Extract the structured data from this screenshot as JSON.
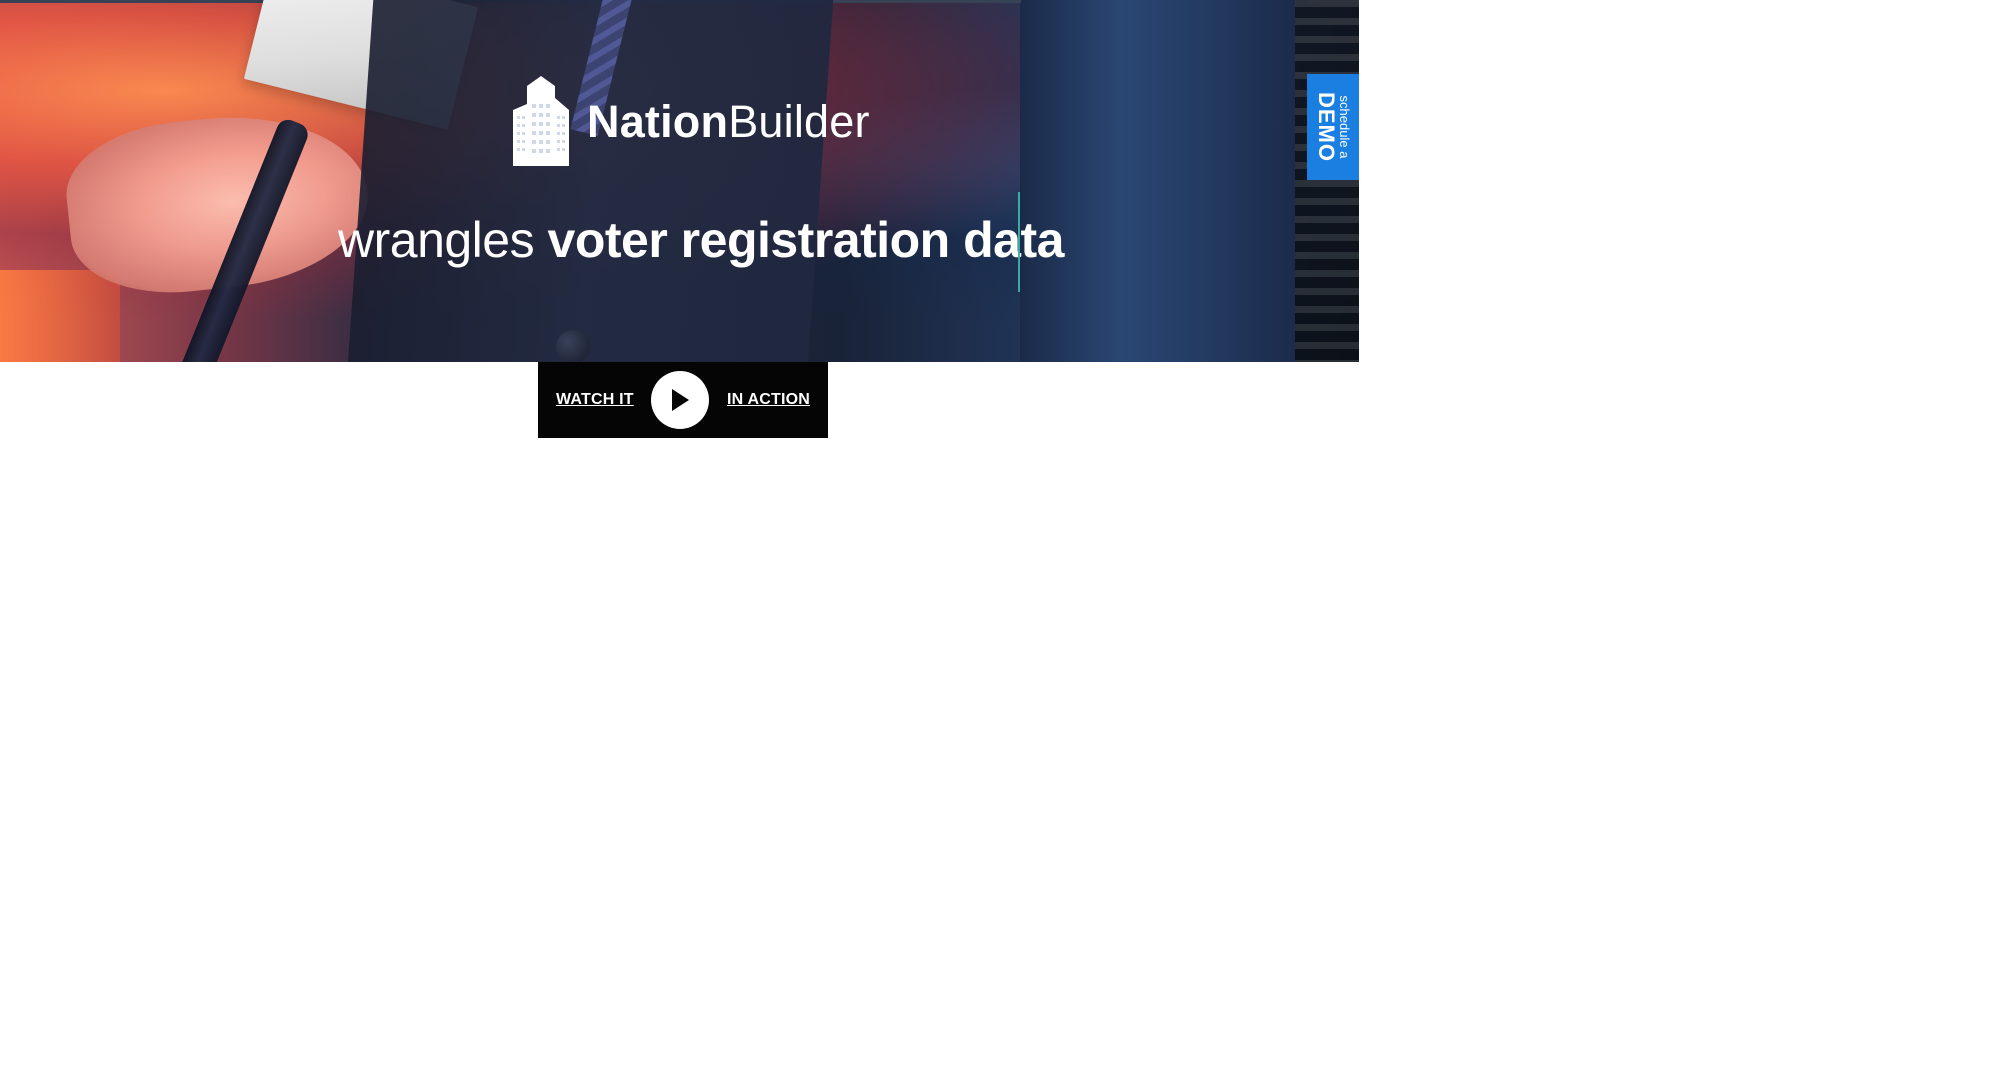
{
  "hero": {
    "brand": {
      "bold": "Nation",
      "light": "Builder"
    },
    "headline": {
      "light": "wrangles",
      "strong": "voter registration data"
    }
  },
  "demo_tab": {
    "small": "schedule a",
    "big": "DEMO"
  },
  "video_cta": {
    "left": "WATCH IT",
    "right": "IN ACTION",
    "icon": "play-icon"
  },
  "colors": {
    "demo_blue": "#1a7fe0",
    "cursor_teal": "#39b3a8",
    "cta_black": "#050505",
    "text_white": "#ffffff"
  }
}
